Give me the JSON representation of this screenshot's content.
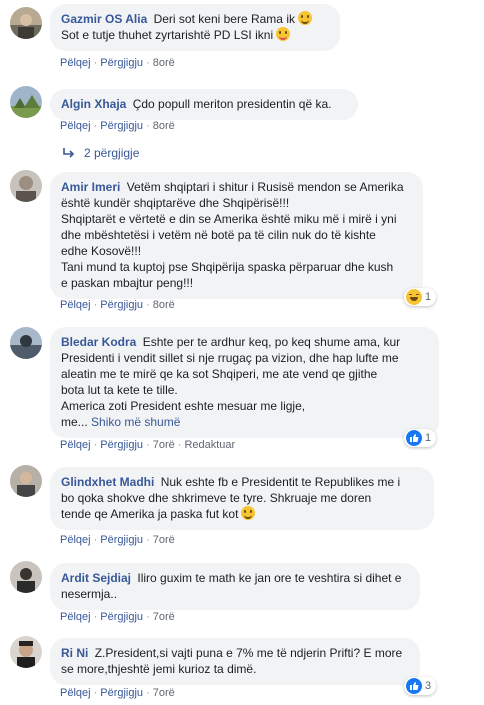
{
  "actions": {
    "like": "Pëlqej",
    "reply": "Përgjigju",
    "sep": "·",
    "edited": "Redaktuar",
    "see_more": "Shiko më shumë"
  },
  "comments": [
    {
      "name": "Gazmir OS Alia",
      "lines": [
        "Deri sot keni bere Rama ik",
        "Sot e tutje thuhet zyrtarishtë PD LSI ikni"
      ],
      "time": "8orë"
    },
    {
      "name": "Algin Xhaja",
      "lines": [
        "Çdo popull meriton presidentin që ka."
      ],
      "time": "8orë",
      "replies": "2 përgjigje"
    },
    {
      "name": "Amir Imeri",
      "lines": [
        "Vetëm shqiptari i shitur i Rusisë mendon se Amerika",
        "është kundër shqiptarëve dhe Shqipërisë!!!",
        "Shqiptarët e vërtetë e din se Amerika është miku më i mirë i yni",
        "dhe mbështetësi i vetëm në botë pa të cilin nuk do të kishte",
        "edhe Kosovë!!!",
        "Tani mund ta kuptoj pse Shqipërija spaska përparuar dhe kush",
        "e paskan mbajtur peng!!!"
      ],
      "time": "8orë",
      "reaction_count": "1"
    },
    {
      "name": "Bledar Kodra",
      "lines": [
        "Eshte per te ardhur keq, po keq shume ama, kur",
        "Presidenti i vendit sillet si nje rrugaç pa vizion, dhe hap lufte me",
        "aleatin me te mirë qe ka sot Shqiperi, me ate vend qe gjithe",
        "bota lut ta kete te tille.",
        "America zoti President eshte mesuar me ligje,",
        "me..."
      ],
      "time": "7orë",
      "reaction_count": "1"
    },
    {
      "name": "Glindxhet Madhi",
      "lines": [
        "Nuk eshte fb e Presidentit te Republikes me i",
        "bo qoka shokve dhe shkrimeve te tyre. Shkruaje me doren",
        "tende qe Amerika ja paska fut kot"
      ],
      "time": "7orë"
    },
    {
      "name": "Ardit Sejdiaj",
      "lines": [
        "Iliro guxim te math ke jan ore te veshtira si dihet e",
        "nesermja.."
      ],
      "time": "7orë"
    },
    {
      "name": "Ri Ni",
      "lines": [
        "Z.President,si vajti puna e 7% me të ndjerin Prifti? E more",
        "se more,thjeshtë jemi kurioz ta dimë."
      ],
      "time": "7orë",
      "reaction_count": "3"
    }
  ]
}
